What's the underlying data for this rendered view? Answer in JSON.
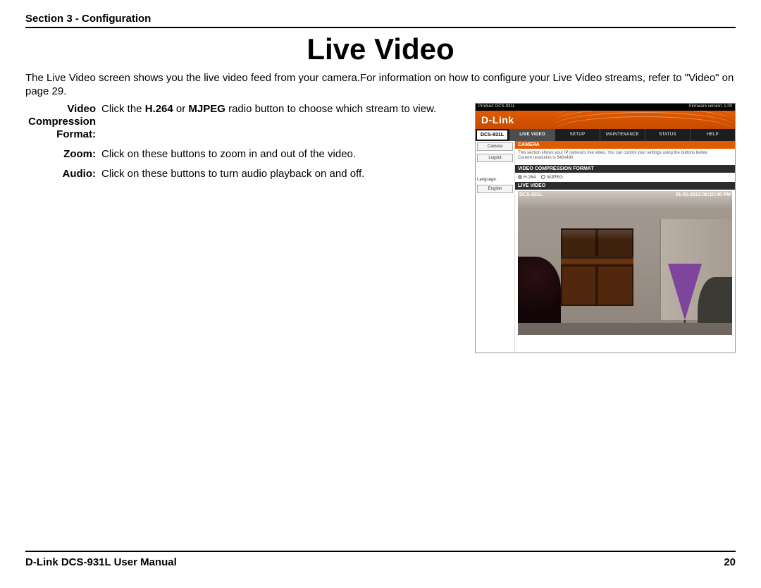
{
  "header": {
    "section": "Section 3 - Configuration"
  },
  "title": "Live Video",
  "intro": "The Live Video screen shows you the live video feed from your camera.For information on how to configure your Live Video streams, refer to \"Video\" on page 29.",
  "defs": {
    "vcf": {
      "label": "Video Compression Format:",
      "text_pre": "Click the ",
      "b1": "H.264",
      "mid": " or ",
      "b2": "MJPEG",
      "text_post": " radio button to choose which stream to view."
    },
    "zoom": {
      "label": "Zoom:",
      "text": "Click on these buttons to zoom in and out of the video."
    },
    "audio": {
      "label": "Audio:",
      "text": "Click on these buttons to turn audio playback on and off."
    }
  },
  "ui": {
    "topbar": {
      "product": "Product: DCS-931L",
      "firmware": "Firmware version: 1.00"
    },
    "brand": "D-Link",
    "model": "DCS-931L",
    "tabs": [
      "LIVE VIDEO",
      "SETUP",
      "MAINTENANCE",
      "STATUS",
      "HELP"
    ],
    "sidebar": {
      "camera": "Camera",
      "logout": "Logout",
      "language_label": "Language :",
      "language_value": "English"
    },
    "camera_panel": {
      "title": "CAMERA",
      "desc1": "This section shows your IP camera's live video. You can control your settings using the buttons below.",
      "desc2": "Current resolution is 640x480."
    },
    "vcf_panel": {
      "title": "VIDEO COMPRESSION FORMAT",
      "opt1": "H.264",
      "opt2": "MJPEG"
    },
    "live_panel": {
      "title": "LIVE VIDEO"
    },
    "osd": {
      "name": "DCS-931L",
      "timestamp": "01-01-2013 09:10:40 PM"
    }
  },
  "footer": {
    "left": "D-Link DCS-931L User Manual",
    "page": "20"
  }
}
